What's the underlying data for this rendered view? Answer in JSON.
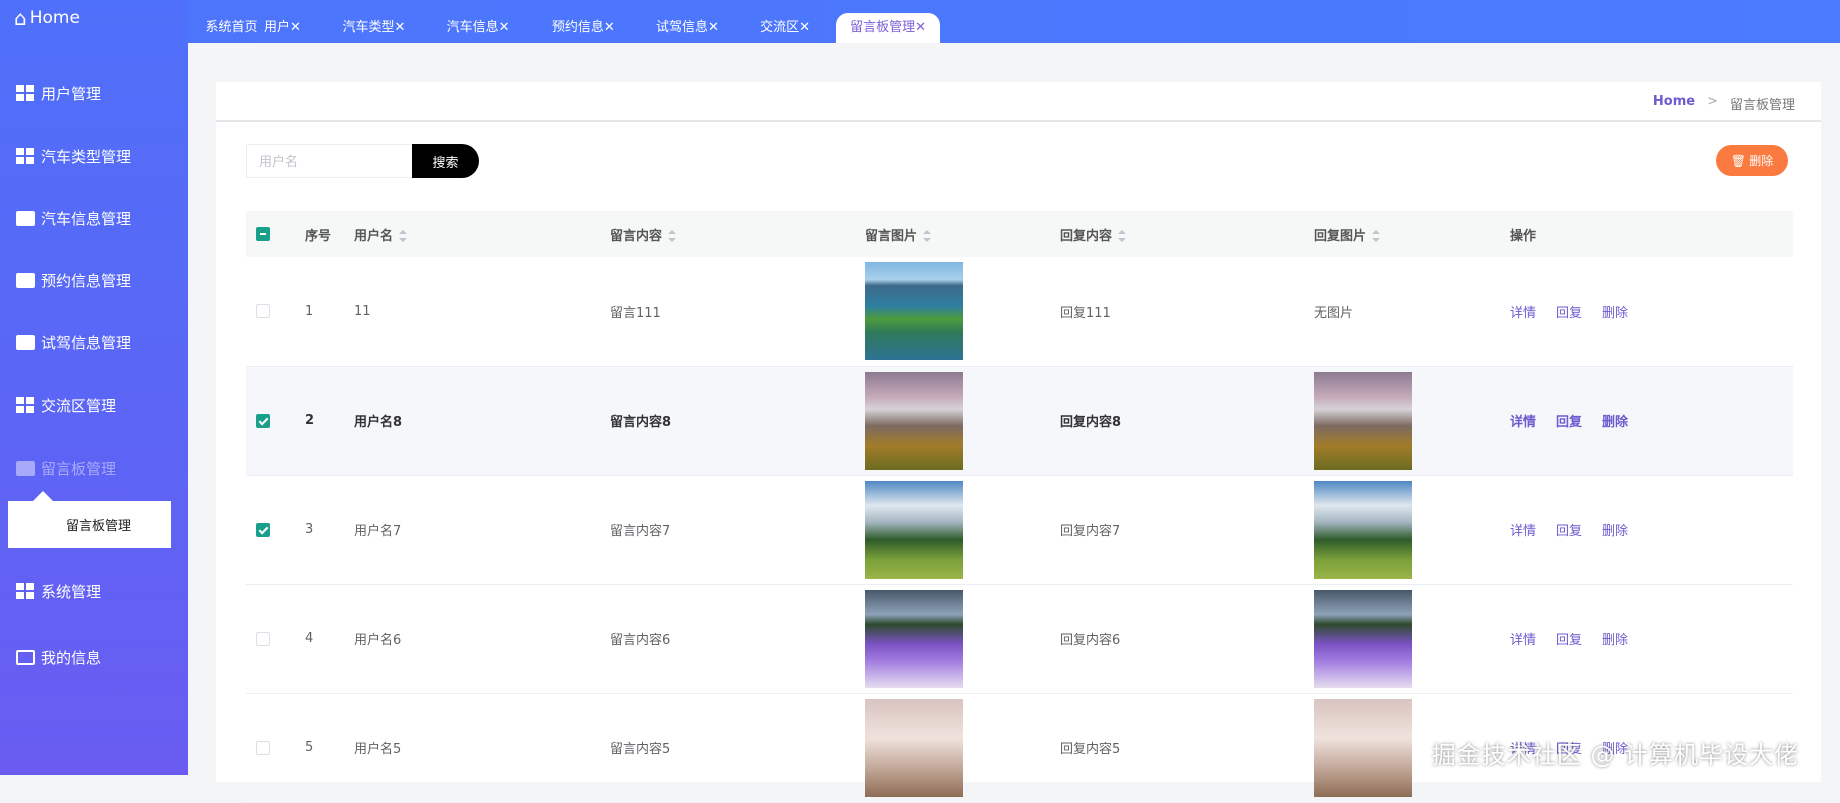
{
  "sidebar": {
    "logo": "Home",
    "items": [
      {
        "label": "用户管理",
        "icon": "grid-icon"
      },
      {
        "label": "汽车类型管理",
        "icon": "grid-icon"
      },
      {
        "label": "汽车信息管理",
        "icon": "ticket-icon"
      },
      {
        "label": "预约信息管理",
        "icon": "briefcase-icon"
      },
      {
        "label": "试驾信息管理",
        "icon": "user-icon"
      },
      {
        "label": "交流区管理",
        "icon": "grid-icon"
      },
      {
        "label": "留言板管理",
        "icon": "bar-chart-icon"
      },
      {
        "label": "系统管理",
        "icon": "grid-icon"
      },
      {
        "label": "我的信息",
        "icon": "card-icon"
      }
    ],
    "submenu": "留言板管理"
  },
  "tabs": [
    "系统首页",
    "用户✕",
    "汽车类型✕",
    "汽车信息✕",
    "预约信息✕",
    "试驾信息✕",
    "交流区✕",
    "留言板管理✕"
  ],
  "breadcrumb": {
    "home": "Home",
    "sep": ">",
    "current": "留言板管理"
  },
  "toolbar": {
    "search_placeholder": "用户名",
    "search_label": "搜索",
    "delete_label": "🗑 删除"
  },
  "table": {
    "headers": [
      "序号",
      "用户名",
      "留言内容",
      "留言图片",
      "回复内容",
      "回复图片",
      "操作"
    ],
    "actions": [
      "详情",
      "回复",
      "删除"
    ],
    "rows": [
      {
        "no": "1",
        "user": "11",
        "content": "留言111",
        "img": "img-city",
        "reply": "回复111",
        "reply_img": "",
        "reply_img_text": "无图片",
        "checked": false
      },
      {
        "no": "2",
        "user": "用户名8",
        "content": "留言内容8",
        "img": "img-mtn",
        "reply": "回复内容8",
        "reply_img": "img-mtn",
        "checked": true
      },
      {
        "no": "3",
        "user": "用户名7",
        "content": "留言内容7",
        "img": "img-snow",
        "reply": "回复内容7",
        "reply_img": "img-snow",
        "checked": true
      },
      {
        "no": "4",
        "user": "用户名6",
        "content": "留言内容6",
        "img": "img-lav",
        "reply": "回复内容6",
        "reply_img": "img-lav",
        "checked": false
      },
      {
        "no": "5",
        "user": "用户名5",
        "content": "留言内容5",
        "img": "img-fog",
        "reply": "回复内容5",
        "reply_img": "img-fog",
        "checked": false
      }
    ]
  },
  "watermark": "掘金技术社区 @ 计算机毕设大佬"
}
